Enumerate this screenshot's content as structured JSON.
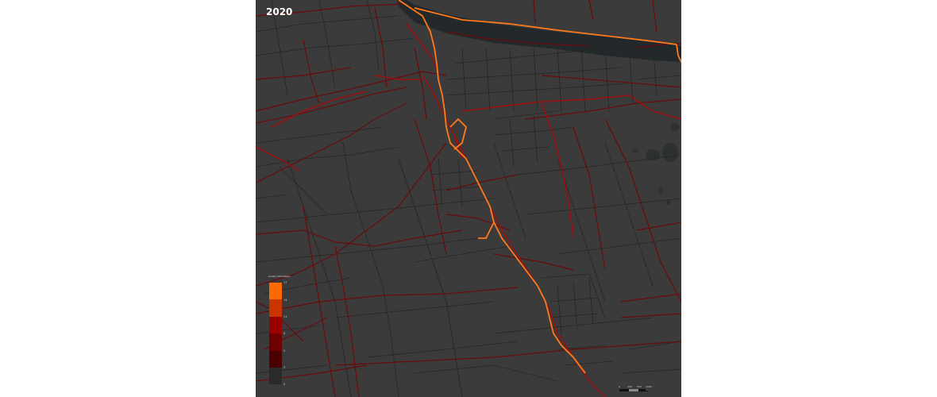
{
  "map": {
    "year": "2020",
    "legend": {
      "title": "Anzahl Aktivitäten",
      "ticks": [
        "17",
        "14",
        "11",
        "8",
        "5",
        "3",
        "0"
      ],
      "colors": [
        "#ff6a00",
        "#c93400",
        "#9a0000",
        "#6e0000",
        "#4a0000",
        "#2a2a2a"
      ]
    },
    "scale": {
      "labels": [
        "0",
        "250",
        "500",
        "1000 m"
      ]
    },
    "colors": {
      "background": "#3b3b3b",
      "minor_road": "#262626",
      "water": "#23292a",
      "low_activity": "#6b0a0a",
      "mid_activity": "#9a1010",
      "high_activity": "#ff7a1a"
    }
  }
}
